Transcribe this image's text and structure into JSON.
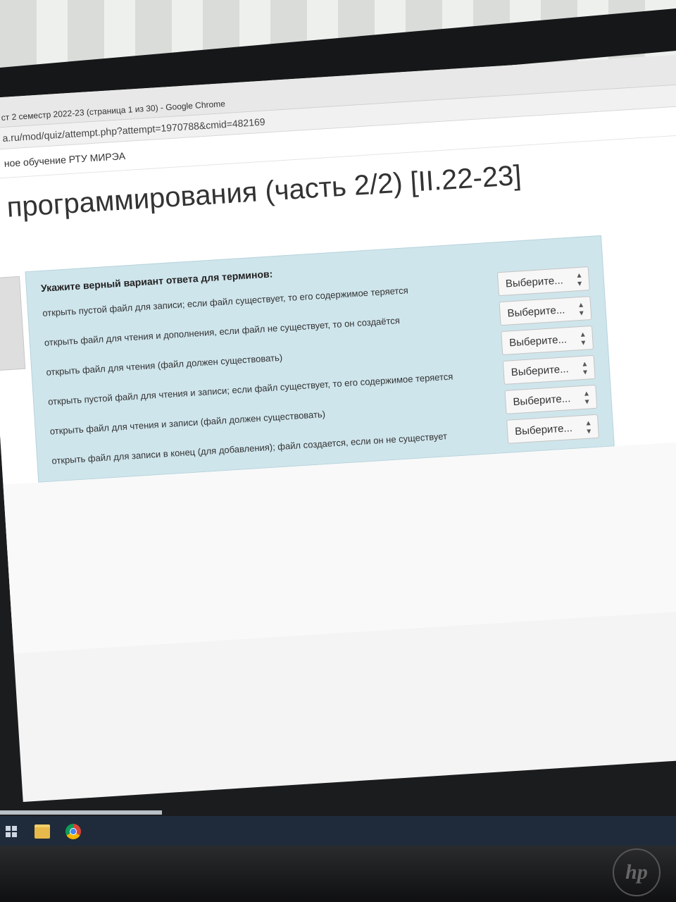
{
  "window": {
    "title": "ст 2 семестр 2022-23 (страница 1 из 30) - Google Chrome"
  },
  "browser": {
    "url": "a.ru/mod/quiz/attempt.php?attempt=1970788&cmid=482169"
  },
  "site": {
    "name": "ное обучение РТУ МИРЭА"
  },
  "page": {
    "heading": "программирования (часть 2/2) [II.22-23]"
  },
  "question": {
    "text": "Укажите верный вариант ответа для терминов:",
    "rows": [
      {
        "term": "открыть пустой файл для записи; если файл существует, то его содержимое теряется",
        "select": "Выберите..."
      },
      {
        "term": "открыть файл для чтения и дополнения, если файл не существует, то он создаётся",
        "select": "Выберите..."
      },
      {
        "term": "открыть файл для чтения (файл должен существовать)",
        "select": "Выберите..."
      },
      {
        "term": "открыть пустой файл для чтения и записи; если файл существует, то его содержимое теряется",
        "select": "Выберите..."
      },
      {
        "term": "открыть файл для чтения и записи (файл должен существовать)",
        "select": "Выберите..."
      },
      {
        "term": "открыть файл для записи в конец (для добавления); файл создается, если он не существует",
        "select": "Выберите..."
      }
    ]
  },
  "taskbar": {
    "icons": [
      "windows-start-icon",
      "file-explorer-icon",
      "chrome-icon"
    ]
  },
  "monitor": {
    "brand": "hp"
  }
}
